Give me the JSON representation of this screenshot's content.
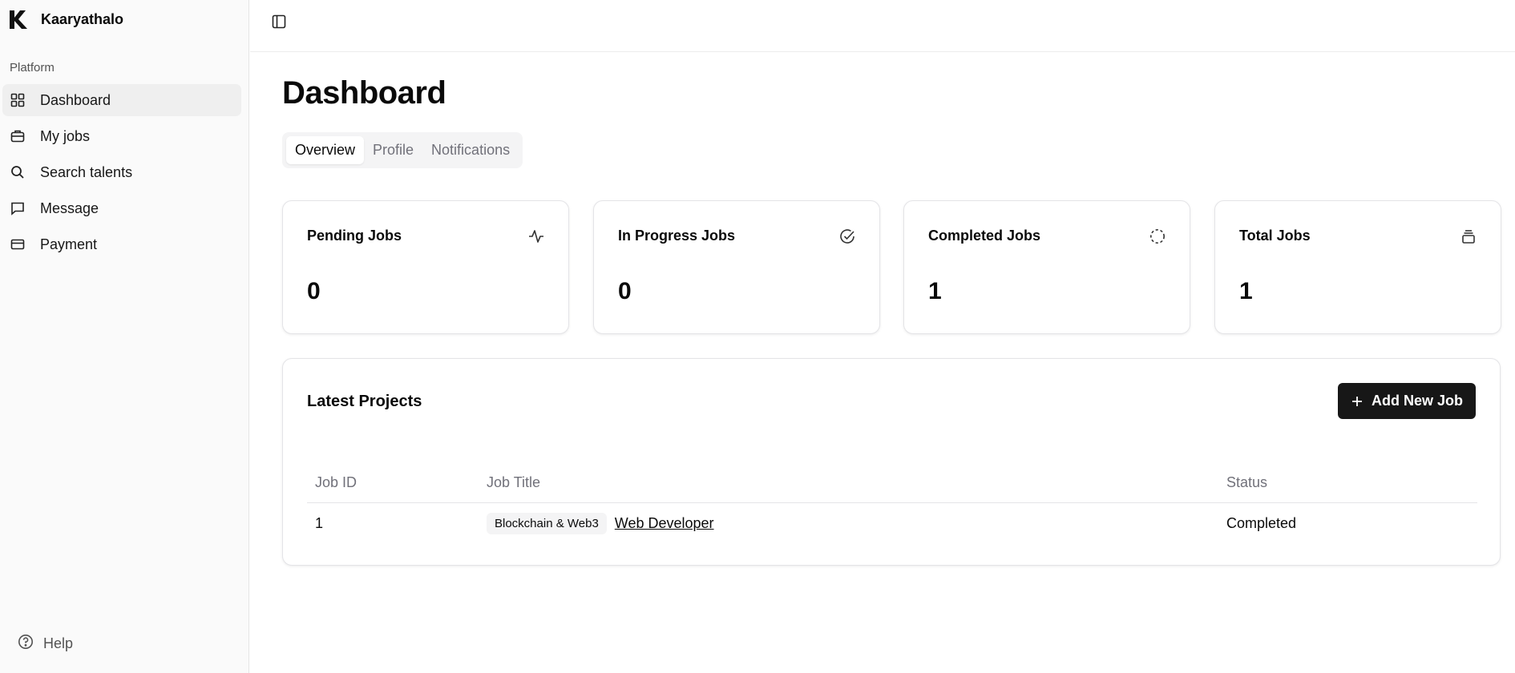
{
  "app": {
    "name": "Kaaryathalo",
    "logo_icon": "k-logo-icon"
  },
  "sidebar": {
    "section_label": "Platform",
    "items": [
      {
        "label": "Dashboard",
        "icon": "grid-icon",
        "active": true
      },
      {
        "label": "My jobs",
        "icon": "briefcase-icon"
      },
      {
        "label": "Search talents",
        "icon": "search-icon"
      },
      {
        "label": "Message",
        "icon": "message-icon"
      },
      {
        "label": "Payment",
        "icon": "credit-card-icon"
      }
    ],
    "help_label": "Help"
  },
  "header": {
    "title": "Dashboard"
  },
  "tabs": [
    {
      "label": "Overview",
      "active": true
    },
    {
      "label": "Profile"
    },
    {
      "label": "Notifications"
    }
  ],
  "stats": [
    {
      "title": "Pending Jobs",
      "value": "0",
      "icon": "activity-icon"
    },
    {
      "title": "In Progress Jobs",
      "value": "0",
      "icon": "check-circle-icon"
    },
    {
      "title": "Completed Jobs",
      "value": "1",
      "icon": "loader-circle-icon"
    },
    {
      "title": "Total Jobs",
      "value": "1",
      "icon": "stack-icon"
    }
  ],
  "projects": {
    "title": "Latest Projects",
    "add_button_label": "Add New Job",
    "columns": [
      "Job ID",
      "Job Title",
      "Status"
    ],
    "rows": [
      {
        "id": "1",
        "category": "Blockchain & Web3",
        "title": "Web Developer",
        "status": "Completed"
      }
    ]
  },
  "colors": {
    "primary": "#171717",
    "sidebar_bg": "#fafafa",
    "muted_text": "#71717a"
  }
}
